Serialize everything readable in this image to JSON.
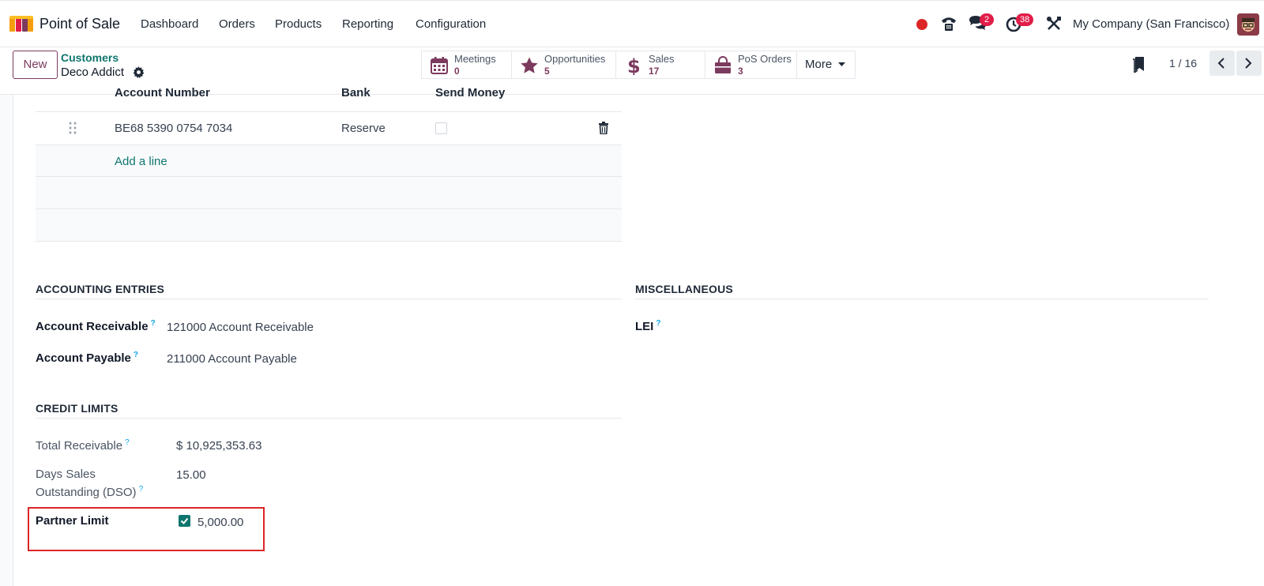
{
  "navbar": {
    "app_name": "Point of Sale",
    "menu": [
      "Dashboard",
      "Orders",
      "Products",
      "Reporting",
      "Configuration"
    ],
    "messages_count": "2",
    "activities_count": "38",
    "company": "My Company (San Francisco)"
  },
  "control": {
    "new_label": "New",
    "breadcrumb_parent": "Customers",
    "breadcrumb_current": "Deco Addict",
    "smart_buttons": [
      {
        "label": "Meetings",
        "value": "0",
        "icon": "calendar-icon"
      },
      {
        "label": "Opportunities",
        "value": "5",
        "icon": "star-icon"
      },
      {
        "label": "Sales",
        "value": "17",
        "icon": "dollar-icon"
      },
      {
        "label": "PoS Orders",
        "value": "3",
        "icon": "shopping-bag-icon"
      }
    ],
    "more_label": "More",
    "pager": "1 / 16"
  },
  "bank_table": {
    "headers": [
      "Account Number",
      "Bank",
      "Send Money"
    ],
    "rows": [
      {
        "account_number": "BE68 5390 0754 7034",
        "bank": "Reserve",
        "send_money": false
      }
    ],
    "add_line": "Add a line"
  },
  "accounting": {
    "title": "ACCOUNTING ENTRIES",
    "receivable_label": "Account Receivable",
    "receivable_value": "121000 Account Receivable",
    "payable_label": "Account Payable",
    "payable_value": "211000 Account Payable",
    "help": "?"
  },
  "misc": {
    "title": "MISCELLANEOUS",
    "lei_label": "LEI"
  },
  "credit": {
    "title": "CREDIT LIMITS",
    "total_receivable_label": "Total Receivable",
    "total_receivable_value": "$ 10,925,353.63",
    "dso_label_1": "Days Sales",
    "dso_label_2": "Outstanding (DSO)",
    "dso_value": "15.00",
    "partner_limit_label": "Partner Limit",
    "partner_limit_checked": true,
    "partner_limit_value": "5,000.00"
  },
  "colors": {
    "brand": "#7c3a5e",
    "link": "#0f766e",
    "badge": "#e11d48",
    "highlight": "#dc2626"
  }
}
